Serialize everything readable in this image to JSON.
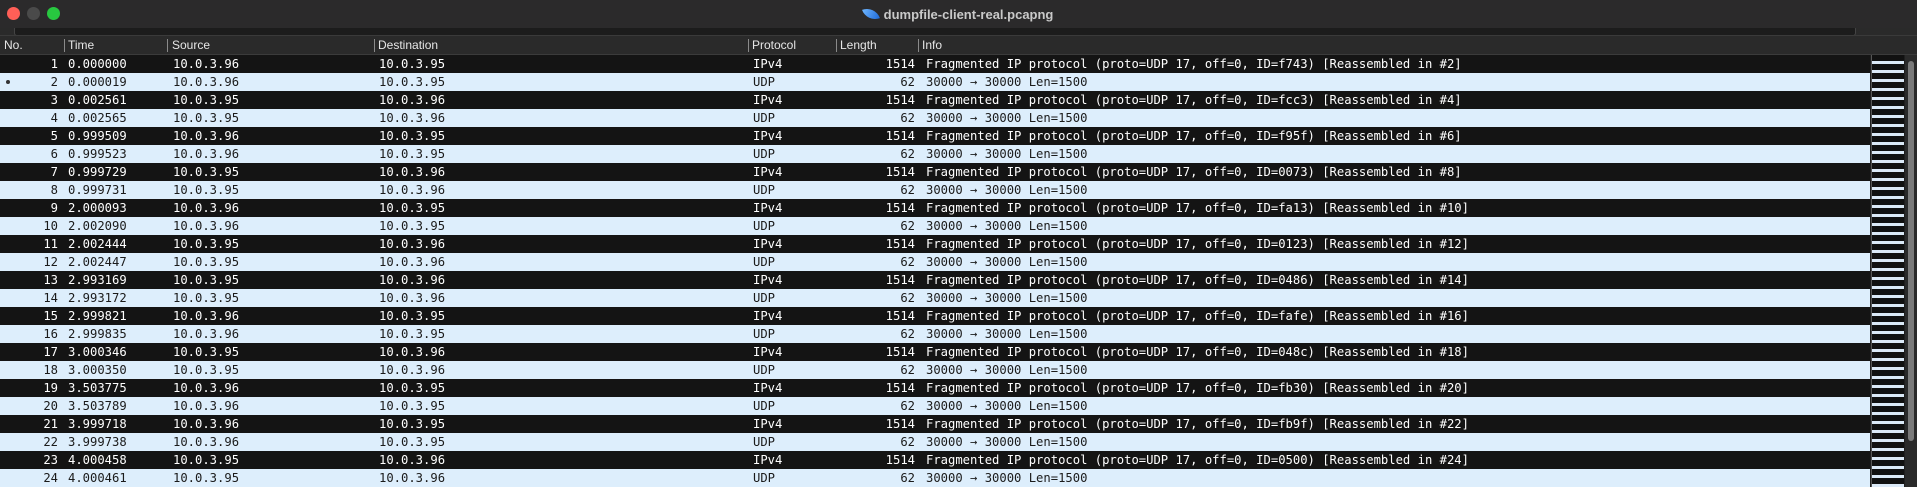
{
  "window": {
    "title": "dumpfile-client-real.pcapng"
  },
  "columns": [
    "No.",
    "Time",
    "Source",
    "Destination",
    "Protocol",
    "Length",
    "Info"
  ],
  "packets": [
    {
      "no": "1",
      "time": "0.000000",
      "src": "10.0.3.96",
      "dst": "10.0.3.95",
      "proto": "IPv4",
      "len": "1514",
      "info": "Fragmented IP protocol (proto=UDP 17, off=0, ID=f743) [Reassembled in #2]"
    },
    {
      "no": "2",
      "time": "0.000019",
      "src": "10.0.3.96",
      "dst": "10.0.3.95",
      "proto": "UDP",
      "len": "62",
      "info": "30000 → 30000 Len=1500"
    },
    {
      "no": "3",
      "time": "0.002561",
      "src": "10.0.3.95",
      "dst": "10.0.3.96",
      "proto": "IPv4",
      "len": "1514",
      "info": "Fragmented IP protocol (proto=UDP 17, off=0, ID=fcc3) [Reassembled in #4]"
    },
    {
      "no": "4",
      "time": "0.002565",
      "src": "10.0.3.95",
      "dst": "10.0.3.96",
      "proto": "UDP",
      "len": "62",
      "info": "30000 → 30000 Len=1500"
    },
    {
      "no": "5",
      "time": "0.999509",
      "src": "10.0.3.96",
      "dst": "10.0.3.95",
      "proto": "IPv4",
      "len": "1514",
      "info": "Fragmented IP protocol (proto=UDP 17, off=0, ID=f95f) [Reassembled in #6]"
    },
    {
      "no": "6",
      "time": "0.999523",
      "src": "10.0.3.96",
      "dst": "10.0.3.95",
      "proto": "UDP",
      "len": "62",
      "info": "30000 → 30000 Len=1500"
    },
    {
      "no": "7",
      "time": "0.999729",
      "src": "10.0.3.95",
      "dst": "10.0.3.96",
      "proto": "IPv4",
      "len": "1514",
      "info": "Fragmented IP protocol (proto=UDP 17, off=0, ID=0073) [Reassembled in #8]"
    },
    {
      "no": "8",
      "time": "0.999731",
      "src": "10.0.3.95",
      "dst": "10.0.3.96",
      "proto": "UDP",
      "len": "62",
      "info": "30000 → 30000 Len=1500"
    },
    {
      "no": "9",
      "time": "2.000093",
      "src": "10.0.3.96",
      "dst": "10.0.3.95",
      "proto": "IPv4",
      "len": "1514",
      "info": "Fragmented IP protocol (proto=UDP 17, off=0, ID=fa13) [Reassembled in #10]"
    },
    {
      "no": "10",
      "time": "2.002090",
      "src": "10.0.3.96",
      "dst": "10.0.3.95",
      "proto": "UDP",
      "len": "62",
      "info": "30000 → 30000 Len=1500"
    },
    {
      "no": "11",
      "time": "2.002444",
      "src": "10.0.3.95",
      "dst": "10.0.3.96",
      "proto": "IPv4",
      "len": "1514",
      "info": "Fragmented IP protocol (proto=UDP 17, off=0, ID=0123) [Reassembled in #12]"
    },
    {
      "no": "12",
      "time": "2.002447",
      "src": "10.0.3.95",
      "dst": "10.0.3.96",
      "proto": "UDP",
      "len": "62",
      "info": "30000 → 30000 Len=1500"
    },
    {
      "no": "13",
      "time": "2.993169",
      "src": "10.0.3.95",
      "dst": "10.0.3.96",
      "proto": "IPv4",
      "len": "1514",
      "info": "Fragmented IP protocol (proto=UDP 17, off=0, ID=0486) [Reassembled in #14]"
    },
    {
      "no": "14",
      "time": "2.993172",
      "src": "10.0.3.95",
      "dst": "10.0.3.96",
      "proto": "UDP",
      "len": "62",
      "info": "30000 → 30000 Len=1500"
    },
    {
      "no": "15",
      "time": "2.999821",
      "src": "10.0.3.96",
      "dst": "10.0.3.95",
      "proto": "IPv4",
      "len": "1514",
      "info": "Fragmented IP protocol (proto=UDP 17, off=0, ID=fafe) [Reassembled in #16]"
    },
    {
      "no": "16",
      "time": "2.999835",
      "src": "10.0.3.96",
      "dst": "10.0.3.95",
      "proto": "UDP",
      "len": "62",
      "info": "30000 → 30000 Len=1500"
    },
    {
      "no": "17",
      "time": "3.000346",
      "src": "10.0.3.95",
      "dst": "10.0.3.96",
      "proto": "IPv4",
      "len": "1514",
      "info": "Fragmented IP protocol (proto=UDP 17, off=0, ID=048c) [Reassembled in #18]"
    },
    {
      "no": "18",
      "time": "3.000350",
      "src": "10.0.3.95",
      "dst": "10.0.3.96",
      "proto": "UDP",
      "len": "62",
      "info": "30000 → 30000 Len=1500"
    },
    {
      "no": "19",
      "time": "3.503775",
      "src": "10.0.3.96",
      "dst": "10.0.3.95",
      "proto": "IPv4",
      "len": "1514",
      "info": "Fragmented IP protocol (proto=UDP 17, off=0, ID=fb30) [Reassembled in #20]"
    },
    {
      "no": "20",
      "time": "3.503789",
      "src": "10.0.3.96",
      "dst": "10.0.3.95",
      "proto": "UDP",
      "len": "62",
      "info": "30000 → 30000 Len=1500"
    },
    {
      "no": "21",
      "time": "3.999718",
      "src": "10.0.3.96",
      "dst": "10.0.3.95",
      "proto": "IPv4",
      "len": "1514",
      "info": "Fragmented IP protocol (proto=UDP 17, off=0, ID=fb9f) [Reassembled in #22]"
    },
    {
      "no": "22",
      "time": "3.999738",
      "src": "10.0.3.96",
      "dst": "10.0.3.95",
      "proto": "UDP",
      "len": "62",
      "info": "30000 → 30000 Len=1500"
    },
    {
      "no": "23",
      "time": "4.000458",
      "src": "10.0.3.95",
      "dst": "10.0.3.96",
      "proto": "IPv4",
      "len": "1514",
      "info": "Fragmented IP protocol (proto=UDP 17, off=0, ID=0500) [Reassembled in #24]"
    },
    {
      "no": "24",
      "time": "4.000461",
      "src": "10.0.3.95",
      "dst": "10.0.3.96",
      "proto": "UDP",
      "len": "62",
      "info": "30000 → 30000 Len=1500"
    }
  ],
  "selected_row": "2",
  "colors": {
    "fragment_row": "#141414",
    "udp_row": "#ddeefc"
  }
}
